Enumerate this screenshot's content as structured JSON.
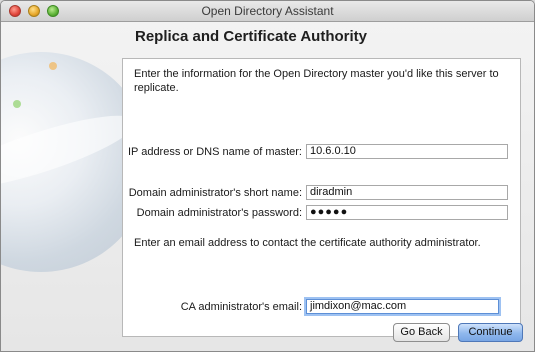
{
  "window": {
    "title": "Open Directory Assistant"
  },
  "page": {
    "title": "Replica and Certificate Authority"
  },
  "master": {
    "intro": "Enter the information for the Open Directory master you'd like this server to replicate.",
    "address_label": "IP address or DNS name of master:",
    "address_value": "10.6.0.10",
    "short_name_label": "Domain administrator's short name:",
    "short_name_value": "diradmin",
    "password_label": "Domain administrator's password:",
    "password_value": "●●●●●"
  },
  "ca": {
    "intro": "Enter an email address to contact the certificate authority administrator.",
    "email_label": "CA administrator's email:",
    "email_value": "jimdixon@mac.com"
  },
  "buttons": {
    "back": "Go Back",
    "continue": "Continue"
  },
  "colors": {
    "primary_button": "#8fb8ed",
    "focus_ring": "#9ec2f2"
  }
}
